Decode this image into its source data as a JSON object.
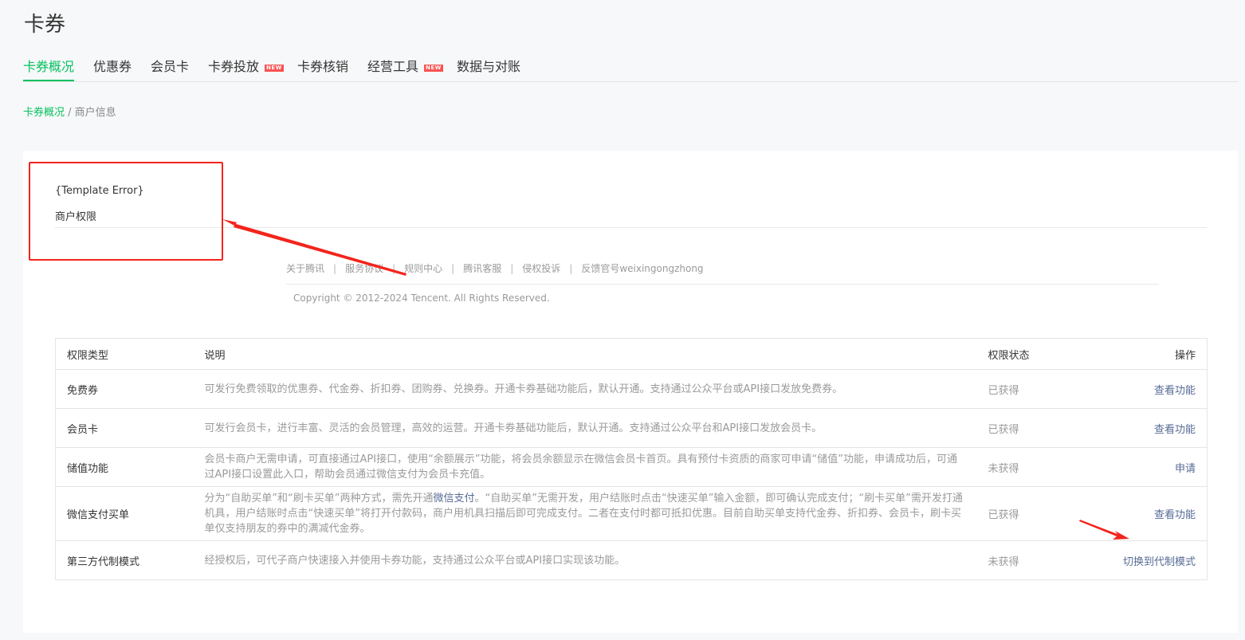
{
  "page_title": "卡券",
  "tabs": [
    {
      "label": "卡券概况",
      "active": true,
      "badge": ""
    },
    {
      "label": "优惠券",
      "active": false,
      "badge": ""
    },
    {
      "label": "会员卡",
      "active": false,
      "badge": ""
    },
    {
      "label": "卡券投放",
      "active": false,
      "badge": "NEW"
    },
    {
      "label": "卡券核销",
      "active": false,
      "badge": ""
    },
    {
      "label": "经营工具",
      "active": false,
      "badge": "NEW"
    },
    {
      "label": "数据与对账",
      "active": false,
      "badge": ""
    }
  ],
  "breadcrumb": {
    "parent": "卡券概况",
    "separator": " / ",
    "current": "商户信息"
  },
  "template_error": "{Template Error}",
  "permission_title": "商户权限",
  "footer": {
    "links": [
      "关于腾讯",
      "服务协议",
      "规则中心",
      "腾讯客服",
      "侵权投诉",
      "反馈官号weixingongzhong"
    ],
    "separator": "|",
    "copyright": "Copyright © 2012-2024 Tencent. All Rights Reserved."
  },
  "table": {
    "headers": [
      "权限类型",
      "说明",
      "权限状态",
      "操作"
    ],
    "rows": [
      {
        "type": "免费券",
        "desc": "可发行免费领取的优惠券、代金券、折扣券、团购券、兑换券。开通卡券基础功能后，默认开通。支持通过公众平台或API接口发放免费券。",
        "status": "已获得",
        "action": "查看功能"
      },
      {
        "type": "会员卡",
        "desc": "可发行会员卡，进行丰富、灵活的会员管理，高效的运营。开通卡券基础功能后，默认开通。支持通过公众平台和API接口发放会员卡。",
        "status": "已获得",
        "action": "查看功能"
      },
      {
        "type": "储值功能",
        "desc": "会员卡商户无需申请，可直接通过API接口，使用“余额展示”功能，将会员余额显示在微信会员卡首页。具有预付卡资质的商家可申请“储值”功能，申请成功后，可通过API接口设置此入口，帮助会员通过微信支付为会员卡充值。",
        "status": "未获得",
        "action": "申请"
      },
      {
        "type": "微信支付买单",
        "desc_before": "分为“自助买单”和“刷卡买单”两种方式，需先开通",
        "desc_link": "微信支付",
        "desc_after": "。“自助买单”无需开发，用户结账时点击“快速买单”输入金额，即可确认完成支付；“刷卡买单”需开发打通机具，用户结账时点击“快速买单”将打开付款码，商户用机具扫描后即可完成支付。二者在支付时都可抵扣优惠。目前自助买单支持代金券、折扣券、会员卡，刷卡买单仅支持朋友的券中的满减代金券。",
        "status": "已获得",
        "action": "查看功能"
      },
      {
        "type": "第三方代制模式",
        "desc": "经授权后，可代子商户快速接入并使用卡券功能，支持通过公众平台或API接口实现该功能。",
        "status": "未获得",
        "action": "切换到代制模式"
      }
    ]
  },
  "colors": {
    "accent": "#07c160",
    "link": "#576b95",
    "annotation": "#f3241c",
    "badge": "#fa5151"
  }
}
